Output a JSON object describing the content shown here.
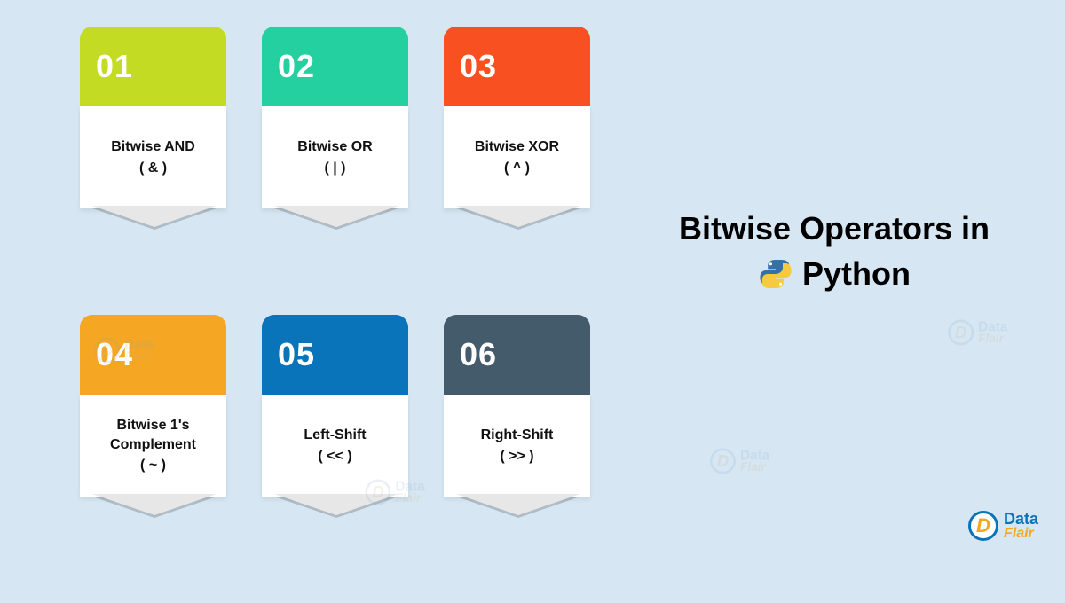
{
  "title_line1": "Bitwise Operators in",
  "title_line2": "Python",
  "brand": {
    "name1": "Data",
    "name2": "Flair",
    "glyph": "D"
  },
  "cards": [
    {
      "num": "01",
      "name": "Bitwise AND",
      "symbol": "( & )",
      "color": "c1"
    },
    {
      "num": "02",
      "name": "Bitwise OR",
      "symbol": "( | )",
      "color": "c2"
    },
    {
      "num": "03",
      "name": "Bitwise XOR",
      "symbol": "( ^ )",
      "color": "c3"
    },
    {
      "num": "04",
      "name": "Bitwise 1's Complement",
      "symbol": "( ~ )",
      "color": "c4"
    },
    {
      "num": "05",
      "name": "Left-Shift",
      "symbol": "( << )",
      "color": "c5"
    },
    {
      "num": "06",
      "name": "Right-Shift",
      "symbol": "( >> )",
      "color": "c6"
    }
  ]
}
